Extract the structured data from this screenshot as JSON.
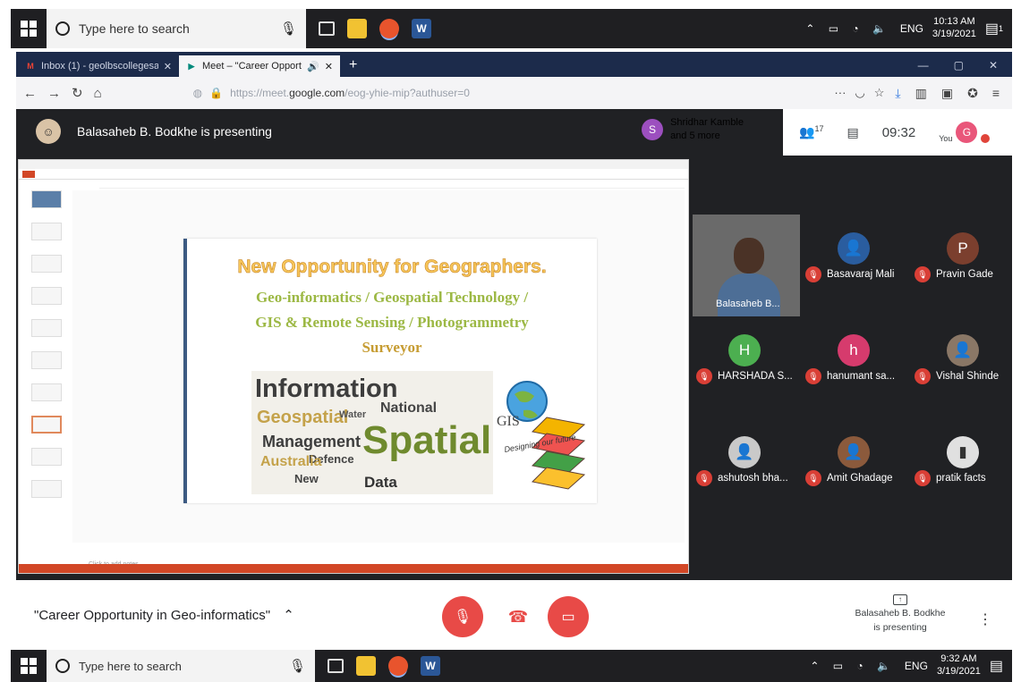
{
  "taskbar_top": {
    "search_placeholder": "Type here to search",
    "language": "ENG",
    "time": "10:13 AM",
    "date": "3/19/2021",
    "notification_count": "1"
  },
  "taskbar_bottom": {
    "search_placeholder": "Type here to search",
    "language": "ENG",
    "time": "9:32 AM",
    "date": "3/19/2021"
  },
  "browser": {
    "tabs": [
      {
        "label": "Inbox (1) - geolbscollegesatar",
        "icon": "gmail-icon",
        "active": false
      },
      {
        "label": "Meet – \"Career Opportunit",
        "icon": "meet-icon",
        "active": true
      }
    ],
    "url_prefix": "https://meet.",
    "url_domain": "google.com",
    "url_path": "/eog-yhie-mip?authuser=0"
  },
  "meet": {
    "presenting_banner": "Balasaheb B. Bodkhe is presenting",
    "others_line1": "Shridhar Kamble",
    "others_line2": "and 5 more",
    "others_initial": "S",
    "participant_count": "17",
    "clock": "09:32",
    "you_label": "You",
    "you_initial": "G",
    "meeting_title": "\"Career Opportunity in Geo-informatics\"",
    "presenter_footer_line1": "Balasaheb B. Bodkhe",
    "presenter_footer_line2": "is presenting",
    "accent_red": "#e84a47"
  },
  "slide": {
    "title": "New Opportunity for Geographers.",
    "line1": "Geo-informatics / Geospatial Technology /",
    "line2": "GIS & Remote Sensing / Photogrammetry",
    "line3": "Surveyor",
    "cloud_words": [
      "Information",
      "Geospatial",
      "Water",
      "National",
      "Management",
      "Spatial",
      "Defence",
      "Australia",
      "New",
      "Data"
    ],
    "gis_label": "GIS",
    "gis_tagline": "Designing our future",
    "notes_placeholder": "Click to add notes"
  },
  "participants": [
    {
      "name": "Balasaheb B...",
      "initial": "",
      "color": "#6a6a6a"
    },
    {
      "name": "Basavaraj Mali",
      "initial": "",
      "color": "#2a5d9f"
    },
    {
      "name": "Pravin Gade",
      "initial": "P",
      "color": "#7b3f2e"
    },
    {
      "name": "HARSHADA S...",
      "initial": "H",
      "color": "#4caf50"
    },
    {
      "name": "hanumant sa...",
      "initial": "h",
      "color": "#d63b6d"
    },
    {
      "name": "Vishal Shinde",
      "initial": "",
      "color": "#8a7766"
    },
    {
      "name": "ashutosh bha...",
      "initial": "",
      "color": "#c9c9c9"
    },
    {
      "name": "Amit Ghadage",
      "initial": "",
      "color": "#8b5a3c"
    },
    {
      "name": "pratik facts",
      "initial": "",
      "color": "#e0e0e0"
    }
  ]
}
